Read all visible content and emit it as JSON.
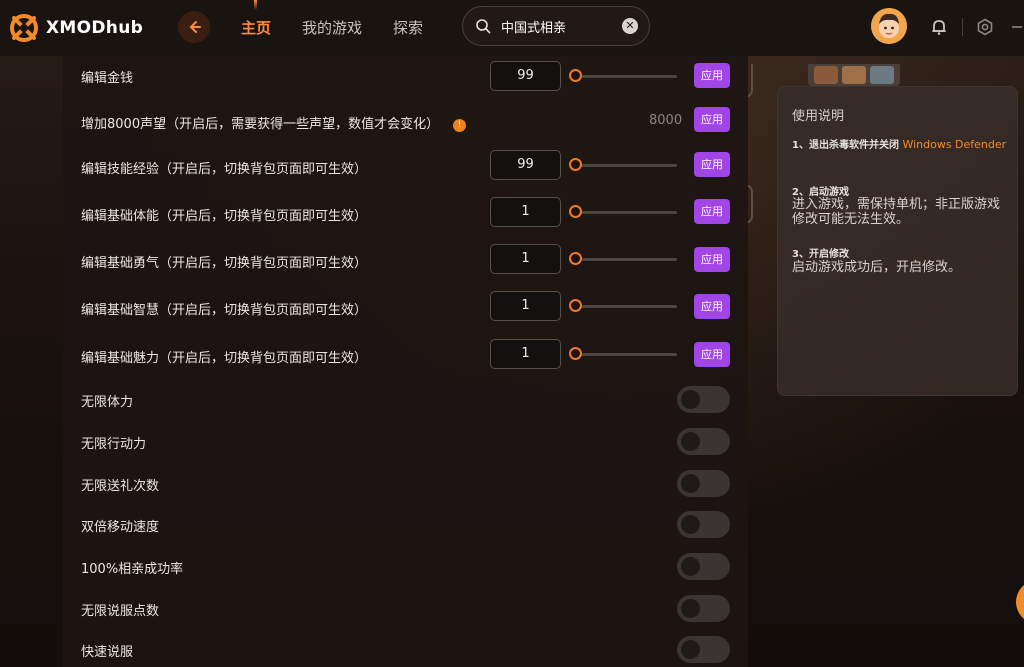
{
  "header": {
    "brand": "XMODhub",
    "nav": [
      {
        "label": "主页",
        "active": true
      },
      {
        "label": "我的游戏",
        "active": false
      },
      {
        "label": "探索",
        "active": false
      }
    ],
    "search_value": "中国式相亲",
    "accent_color": "#ff8a3d"
  },
  "mods": {
    "apply_label": "应用",
    "sliders": [
      {
        "label": "编辑金钱",
        "value": "99"
      },
      {
        "label": "增加8000声望（开启后，需要获得一些声望，数值才会变化）",
        "value": "8000",
        "info": "!"
      },
      {
        "label": "编辑技能经验（开启后，切换背包页面即可生效）",
        "value": "99"
      },
      {
        "label": "编辑基础体能（开启后，切换背包页面即可生效）",
        "value": "1"
      },
      {
        "label": "编辑基础勇气（开启后，切换背包页面即可生效）",
        "value": "1"
      },
      {
        "label": "编辑基础智慧（开启后，切换背包页面即可生效）",
        "value": "1"
      },
      {
        "label": "编辑基础魅力（开启后，切换背包页面即可生效）",
        "value": "1"
      }
    ],
    "toggles": [
      {
        "label": "无限体力",
        "on": false
      },
      {
        "label": "无限行动力",
        "on": false
      },
      {
        "label": "无限送礼次数",
        "on": false
      },
      {
        "label": "双倍移动速度",
        "on": false
      },
      {
        "label": "100%相亲成功率",
        "on": false
      },
      {
        "label": "无限说服点数",
        "on": false
      },
      {
        "label": "快速说服",
        "on": false
      }
    ]
  },
  "instructions": {
    "title": "使用说明",
    "steps": [
      {
        "head": "1、退出杀毒软件并关闭",
        "link": "Windows Defender",
        "body": ""
      },
      {
        "head": "2、启动游戏",
        "link": "",
        "body": "进入游戏，需保持单机；非正版游戏修改可能无法生效。"
      },
      {
        "head": "3、开启修改",
        "link": "",
        "body": "启动游戏成功后，开启修改。"
      }
    ],
    "link_color": "#f08b2e"
  },
  "colors": {
    "apply_button": "#a145e6",
    "slider_thumb": "#f07a2a"
  }
}
